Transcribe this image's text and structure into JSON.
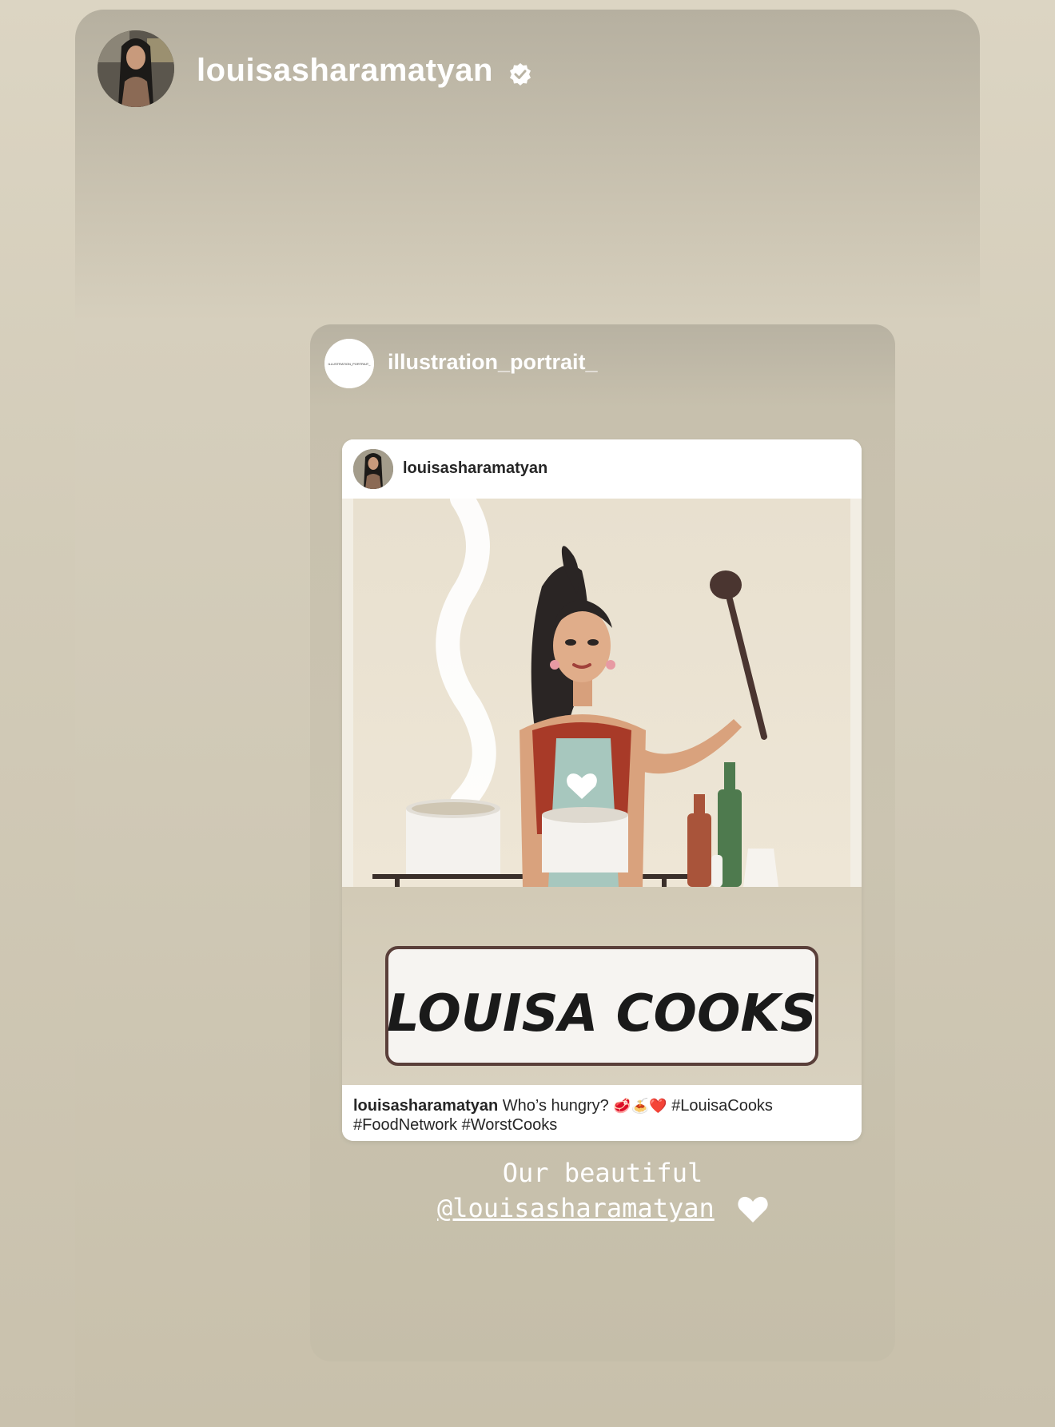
{
  "story": {
    "username": "louisasharamatyan",
    "verified": true
  },
  "shared_post": {
    "username": "illustration_portrait_",
    "avatar_text": "ILLUSTRATION_PORTRAIT_",
    "post": {
      "username": "louisasharamatyan",
      "image": {
        "sign_text": "LOUISA COOKS"
      },
      "caption": {
        "username": "louisasharamatyan",
        "text": "Who’s hungry?",
        "emojis": "🥩🍝❤️",
        "hashtags_line1": "#LouisaCooks",
        "hashtags_line2": "#FoodNetwork #WorstCooks"
      }
    },
    "story_text": {
      "line1": "Our beautiful",
      "mention": "@louisasharamatyan"
    }
  },
  "colors": {
    "background": "#d6cfbd",
    "text_light": "#ffffff",
    "post_text": "#262626",
    "apron": "#a7c7be",
    "top_red": "#a83a28"
  }
}
